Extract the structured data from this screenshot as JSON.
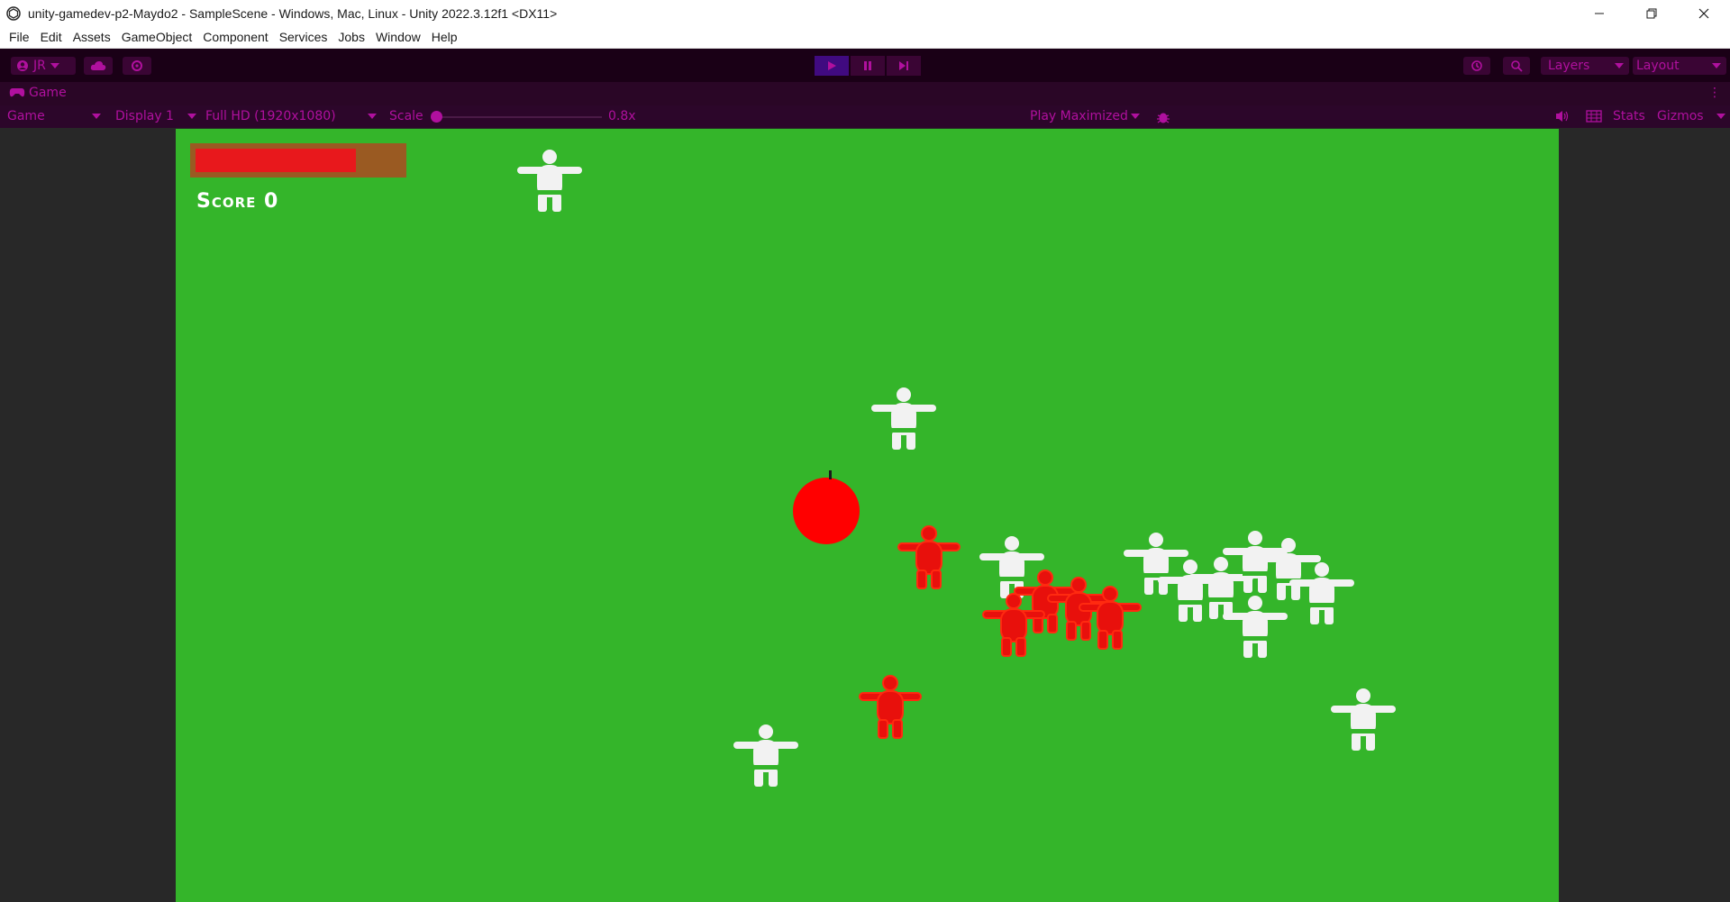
{
  "window": {
    "title": "unity-gamedev-p2-Maydo2 - SampleScene - Windows, Mac, Linux - Unity 2022.3.12f1 <DX11>"
  },
  "menu": [
    "File",
    "Edit",
    "Assets",
    "GameObject",
    "Component",
    "Services",
    "Jobs",
    "Window",
    "Help"
  ],
  "toolbar": {
    "account": "JR",
    "layers": "Layers",
    "layout": "Layout",
    "accent_color": "#b0109e",
    "background_color": "#1a0016"
  },
  "tab": {
    "label": "Game"
  },
  "game_controls": {
    "view_mode": "Game",
    "display": "Display 1",
    "resolution": "Full HD (1920x1080)",
    "scale_label": "Scale",
    "scale_value": "0.8x",
    "play_mode": "Play Maximized",
    "stats": "Stats",
    "gizmos": "Gizmos"
  },
  "game": {
    "background_color": "#34b52a",
    "health_fraction": 0.74,
    "score_text": "Score 0",
    "player_color": "#ff0000",
    "enemy_colors": {
      "neutral": "#f2f2f2",
      "attacked": "#e8100c"
    }
  }
}
